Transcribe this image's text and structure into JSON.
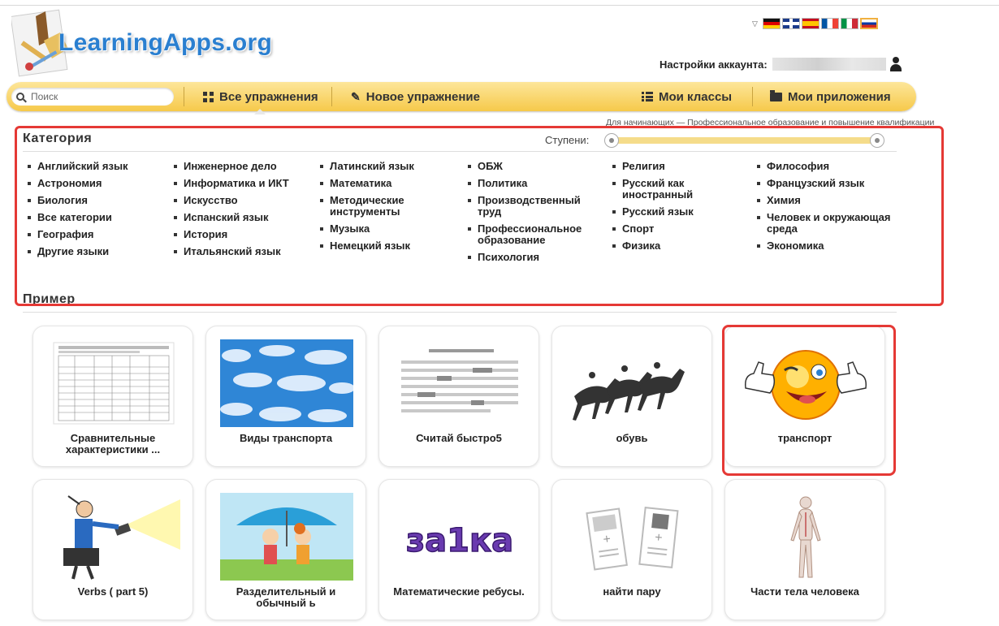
{
  "header": {
    "logo_text": "LearningApps.org",
    "account_label": "Настройки аккаунта:",
    "flags": [
      "de",
      "gb",
      "es",
      "fr",
      "it",
      "ru"
    ]
  },
  "nav": {
    "search_placeholder": "Поиск",
    "all_exercises": "Все упражнения",
    "new_exercise": "Новое упражнение",
    "my_classes": "Мои классы",
    "my_apps": "Мои приложения"
  },
  "levels_note": "Для начинающих — Профессиональное образование и повышение квалификации",
  "category": {
    "title": "Категория",
    "steps_label": "Ступени:",
    "columns": [
      [
        "Английский язык",
        "Астрономия",
        "Биология",
        "Все категории",
        "География",
        "Другие языки"
      ],
      [
        "Инженерное дело",
        "Информатика и ИКТ",
        "Искусство",
        "Испанский язык",
        "История",
        "Итальянский язык"
      ],
      [
        "Латинский язык",
        "Математика",
        "Методические инструменты",
        "Музыка",
        "Немецкий язык"
      ],
      [
        "ОБЖ",
        "Политика",
        "Производственный труд",
        "Профессиональное образование",
        "Психология"
      ],
      [
        "Религия",
        "Русский как иностранный",
        "Русский язык",
        "Спорт",
        "Физика"
      ],
      [
        "Философия",
        "Французский язык",
        "Химия",
        "Человек и окружающая среда",
        "Экономика"
      ]
    ]
  },
  "example": {
    "title": "Пример",
    "cards": [
      {
        "label": "Сравнительные характеристики ...",
        "icon": "table-thumbnail"
      },
      {
        "label": "Виды транспорта",
        "icon": "sky-clouds-thumbnail"
      },
      {
        "label": "Считай быстро5",
        "icon": "text-lines-thumbnail"
      },
      {
        "label": "обувь",
        "icon": "horse-race-thumbnail"
      },
      {
        "label": "транспорт",
        "icon": "winking-smiley-thumbnail"
      },
      {
        "label": "Verbs ( part 5)",
        "icon": "flashlight-man-thumbnail"
      },
      {
        "label": "Разделительный и обычный ь",
        "icon": "kids-umbrella-thumbnail"
      },
      {
        "label": "Математические ребусы.",
        "icon": "za1ka-thumbnail"
      },
      {
        "label": "найти пару",
        "icon": "pair-cards-thumbnail"
      },
      {
        "label": "Части тела человека",
        "icon": "human-anatomy-thumbnail"
      }
    ],
    "za1ka_text": "за1ка"
  },
  "colors": {
    "accent": "#2a7fd0",
    "nav": "#f6c94a",
    "highlight": "#e53935"
  }
}
